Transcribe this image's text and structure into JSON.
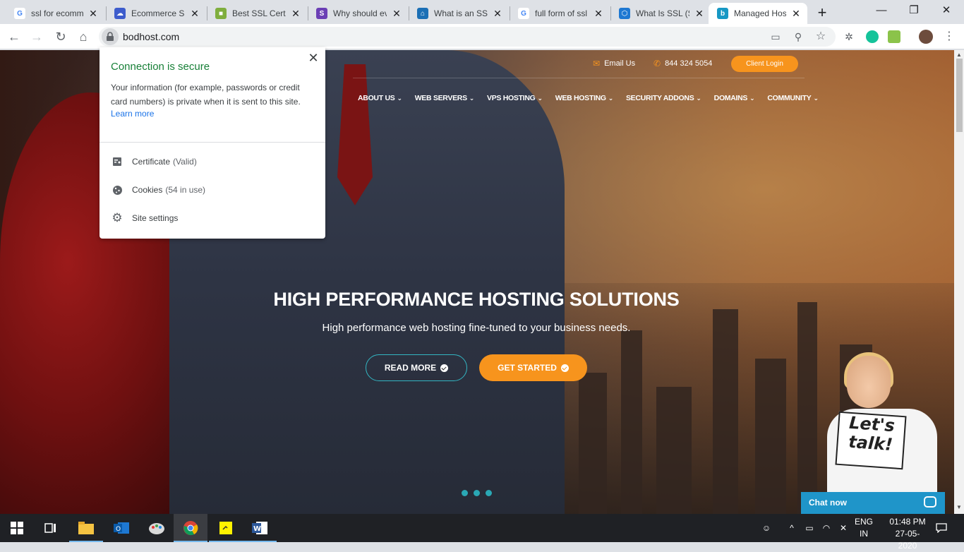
{
  "browser": {
    "tabs": [
      {
        "title": "ssl for ecommerce",
        "favicon": "google-icon",
        "color": "#4285f4"
      },
      {
        "title": "Ecommerce SSL",
        "favicon": "cloud-icon",
        "color": "#3d5ccc"
      },
      {
        "title": "Best SSL Certificate",
        "favicon": "cube-icon",
        "color": "#7fae3d"
      },
      {
        "title": "Why should every",
        "favicon": "s-icon",
        "color": "#6b3fb5"
      },
      {
        "title": "What is an SSL",
        "favicon": "house-icon",
        "color": "#1b6fb5"
      },
      {
        "title": "full form of ssl",
        "favicon": "google-icon",
        "color": "#4285f4"
      },
      {
        "title": "What Is SSL (Secure",
        "favicon": "hexagon-icon",
        "color": "#1e78d2"
      },
      {
        "title": "Managed Hosting",
        "favicon": "bodhost-icon",
        "color": "#1798c4",
        "active": true
      }
    ],
    "url": "bodhost.com"
  },
  "security_popup": {
    "heading": "Connection is secure",
    "body": "Your information (for example, passwords or credit card numbers) is private when it is sent to this site.",
    "learn_more": "Learn more",
    "items": [
      {
        "label": "Certificate",
        "sub": "(Valid)",
        "icon": "certificate-icon"
      },
      {
        "label": "Cookies",
        "sub": "(54 in use)",
        "icon": "cookie-icon"
      },
      {
        "label": "Site settings",
        "sub": "",
        "icon": "gear-icon"
      }
    ]
  },
  "site": {
    "email_label": "Email Us",
    "phone": "844 324 5054",
    "client_login": "Client Login",
    "nav": [
      "ABOUT US",
      "WEB SERVERS",
      "VPS HOSTING",
      "WEB HOSTING",
      "SECURITY ADDONS",
      "DOMAINS",
      "COMMUNITY"
    ],
    "hero_title": "HIGH PERFORMANCE HOSTING SOLUTIONS",
    "hero_sub": "High performance web hosting fine-tuned to your business needs.",
    "read_more": "READ MORE",
    "get_started": "GET STARTED",
    "sign_line1": "Let's",
    "sign_line2": "talk!",
    "chat": "Chat now",
    "accent": "#f7941d",
    "teal": "#2aa8b5"
  },
  "taskbar": {
    "lang_line1": "ENG",
    "lang_line2": "IN",
    "time": "01:48 PM",
    "date": "27-05-2020"
  }
}
